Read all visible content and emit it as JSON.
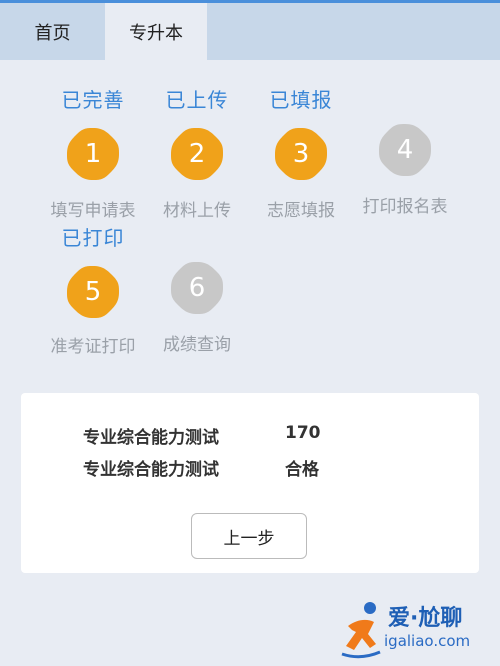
{
  "tabs": [
    {
      "label": "首页",
      "active": false
    },
    {
      "label": "专升本",
      "active": true
    }
  ],
  "steps": [
    {
      "number": "1",
      "status": "已完善",
      "label": "填写申请表",
      "state": "done"
    },
    {
      "number": "2",
      "status": "已上传",
      "label": "材料上传",
      "state": "done"
    },
    {
      "number": "3",
      "status": "已填报",
      "label": "志愿填报",
      "state": "done"
    },
    {
      "number": "4",
      "status": "",
      "label": "打印报名表",
      "state": "pending"
    },
    {
      "number": "5",
      "status": "已打印",
      "label": "准考证打印",
      "state": "done"
    },
    {
      "number": "6",
      "status": "",
      "label": "成绩查询",
      "state": "pending"
    }
  ],
  "results": [
    {
      "subject": "专业综合能力测试",
      "value": "170"
    },
    {
      "subject": "专业综合能力测试",
      "value": "合格"
    }
  ],
  "back_button": "上一步",
  "watermark": {
    "brand": "爱·尬聊",
    "url": "igaliao.com"
  },
  "colors": {
    "accent": "#3a86d6",
    "done": "#f0a21a",
    "pending": "#c8c8c8",
    "tabbar": "#c7d7e9",
    "background": "#e8ecf3"
  }
}
